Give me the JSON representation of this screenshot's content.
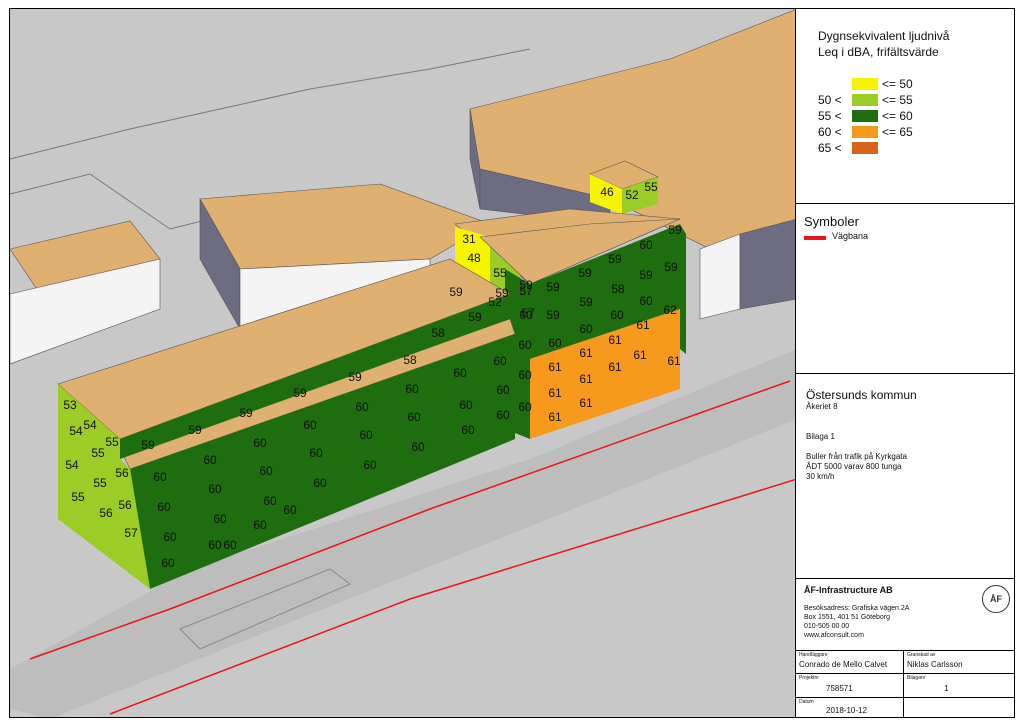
{
  "legend": {
    "title_line1": "Dygnsekvivalent ljudnivå",
    "title_line2": "Leq i dBA, frifältsvärde",
    "items": [
      {
        "range_left": "",
        "range_right": "<= 50",
        "color": "#f7f400"
      },
      {
        "range_left": "50 <",
        "range_right": "<= 55",
        "color": "#9ccc26"
      },
      {
        "range_left": "55 <",
        "range_right": "<= 60",
        "color": "#1e6e10"
      },
      {
        "range_left": "60 <",
        "range_right": "<= 65",
        "color": "#f7991c"
      },
      {
        "range_left": "65 <",
        "range_right": "",
        "color": "#d8641c"
      }
    ]
  },
  "symbols": {
    "heading": "Symboler",
    "items": [
      {
        "label": "Vägbana",
        "color": "#e8161c"
      }
    ]
  },
  "project": {
    "municipality": "Östersunds kommun",
    "area": "Åkeriet 8",
    "appendix": "Bilaga 1",
    "desc_line1": "Buller från trafik på Kyrkgata",
    "desc_line2": "ÅDT 5000 varav 800 tunga",
    "desc_line3": "30 km/h"
  },
  "company": {
    "name": "ÅF-Infrastructure AB",
    "address1": "Besöksadress: Grafiska vägen 2A",
    "address2": "Box 1551, 401 51 Göteborg",
    "phone": "010-505 00 00",
    "web": "www.afconsult.com",
    "logo_text": "ÅF"
  },
  "titleblock": {
    "handlaggare_label": "Handläggare",
    "handlaggare": "Conrado de Mello Calvet",
    "granskad_label": "Granskad av",
    "granskad": "Niklas Carlsson",
    "projekt_label": "Projektnr",
    "projekt": "758571",
    "bilaga_label": "Bilaganr",
    "bilaga": "1",
    "datum_label": "Datum",
    "datum": "2018-10-12"
  },
  "scene": {
    "colors": {
      "ground": "#c8c8c8",
      "road": "#bdbdbd",
      "roof": "#e0b070",
      "wall_dark": "#6e6c82",
      "wall_light": "#f4f4f4",
      "road_line": "#e8161c"
    },
    "facade_values": [
      {
        "text": "53"
      },
      {
        "text": "54"
      },
      {
        "text": "55"
      },
      {
        "text": "54"
      },
      {
        "text": "55"
      },
      {
        "text": "56"
      },
      {
        "text": "54"
      },
      {
        "text": "55"
      },
      {
        "text": "56"
      },
      {
        "text": "55"
      },
      {
        "text": "56"
      },
      {
        "text": "57"
      },
      {
        "text": "59"
      },
      {
        "text": "59"
      },
      {
        "text": "59"
      },
      {
        "text": "59"
      },
      {
        "text": "59"
      },
      {
        "text": "58"
      },
      {
        "text": "58"
      },
      {
        "text": "59"
      },
      {
        "text": "59"
      },
      {
        "text": "59"
      },
      {
        "text": "59"
      },
      {
        "text": "60"
      },
      {
        "text": "60"
      },
      {
        "text": "60"
      },
      {
        "text": "60"
      },
      {
        "text": "60"
      },
      {
        "text": "60"
      },
      {
        "text": "60"
      },
      {
        "text": "60"
      },
      {
        "text": "60"
      },
      {
        "text": "60"
      },
      {
        "text": "60"
      },
      {
        "text": "60"
      },
      {
        "text": "60"
      },
      {
        "text": "60"
      },
      {
        "text": "60"
      },
      {
        "text": "60"
      },
      {
        "text": "60"
      },
      {
        "text": "60"
      },
      {
        "text": "60"
      },
      {
        "text": "60"
      },
      {
        "text": "60"
      },
      {
        "text": "60"
      },
      {
        "text": "60"
      },
      {
        "text": "60"
      },
      {
        "text": "60"
      },
      {
        "text": "60"
      },
      {
        "text": "60"
      },
      {
        "text": "60"
      },
      {
        "text": "60"
      },
      {
        "text": "60"
      },
      {
        "text": "59"
      },
      {
        "text": "59"
      },
      {
        "text": "59"
      },
      {
        "text": "60"
      },
      {
        "text": "59"
      },
      {
        "text": "59"
      },
      {
        "text": "59"
      },
      {
        "text": "58"
      },
      {
        "text": "59"
      },
      {
        "text": "59"
      },
      {
        "text": "60"
      },
      {
        "text": "60"
      },
      {
        "text": "60"
      },
      {
        "text": "60"
      },
      {
        "text": "61"
      },
      {
        "text": "61"
      },
      {
        "text": "61"
      },
      {
        "text": "61"
      },
      {
        "text": "62"
      },
      {
        "text": "61"
      },
      {
        "text": "61"
      },
      {
        "text": "61"
      },
      {
        "text": "61"
      },
      {
        "text": "61"
      },
      {
        "text": "61"
      },
      {
        "text": "61"
      },
      {
        "text": "48"
      },
      {
        "text": "55"
      },
      {
        "text": "57"
      },
      {
        "text": "57"
      },
      {
        "text": "52"
      },
      {
        "text": "46"
      },
      {
        "text": "52"
      },
      {
        "text": "55"
      },
      {
        "text": "31"
      },
      {
        "text": "60"
      },
      {
        "text": "60"
      },
      {
        "text": "60"
      }
    ]
  }
}
